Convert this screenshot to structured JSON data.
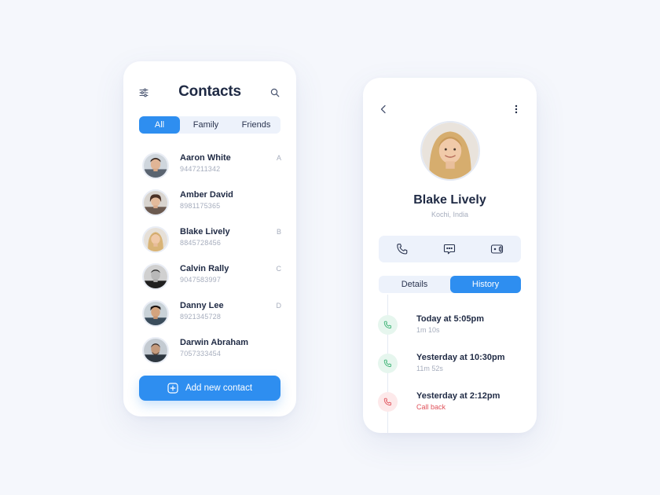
{
  "colors": {
    "accent": "#2e8ef0",
    "background": "#f5f7fc",
    "missed": "#e0525b",
    "success": "#3bb273"
  },
  "contacts_screen": {
    "title": "Contacts",
    "icons": {
      "filter": "sliders-icon",
      "search": "search-icon"
    },
    "tabs": [
      {
        "label": "All",
        "active": true
      },
      {
        "label": "Family",
        "active": false
      },
      {
        "label": "Friends",
        "active": false
      }
    ],
    "contacts": [
      {
        "name": "Aaron White",
        "phone": "9447211342",
        "letter": "A"
      },
      {
        "name": "Amber David",
        "phone": "8981175365",
        "letter": ""
      },
      {
        "name": "Blake Lively",
        "phone": "8845728456",
        "letter": "B"
      },
      {
        "name": "Calvin Rally",
        "phone": "9047583997",
        "letter": "C"
      },
      {
        "name": "Danny Lee",
        "phone": "8921345728",
        "letter": "D"
      },
      {
        "name": "Darwin Abraham",
        "phone": "7057333454",
        "letter": ""
      }
    ],
    "add_button_label": "Add new contact"
  },
  "detail_screen": {
    "icons": {
      "back": "chevron-left-icon",
      "more": "more-vertical-icon"
    },
    "name": "Blake Lively",
    "location": "Kochi, India",
    "actions": [
      "phone-icon",
      "message-icon",
      "video-icon"
    ],
    "tabs": [
      {
        "label": "Details",
        "active": false
      },
      {
        "label": "History",
        "active": true
      }
    ],
    "history": [
      {
        "title": "Today at 5:05pm",
        "subtitle": "1m 10s",
        "status": "answered"
      },
      {
        "title": "Yesterday at 10:30pm",
        "subtitle": "11m 52s",
        "status": "answered"
      },
      {
        "title": "Yesterday at 2:12pm",
        "subtitle": "Call back",
        "status": "missed"
      }
    ]
  }
}
